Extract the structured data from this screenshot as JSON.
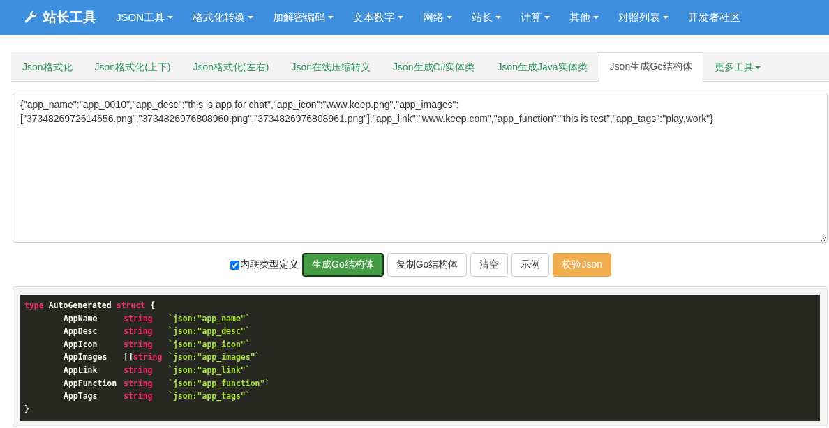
{
  "navbar": {
    "brand": "站长工具",
    "items": [
      {
        "label": "JSON工具",
        "dropdown": true
      },
      {
        "label": "格式化转换",
        "dropdown": true
      },
      {
        "label": "加解密编码",
        "dropdown": true
      },
      {
        "label": "文本数字",
        "dropdown": true
      },
      {
        "label": "网络",
        "dropdown": true
      },
      {
        "label": "站长",
        "dropdown": true
      },
      {
        "label": "计算",
        "dropdown": true
      },
      {
        "label": "其他",
        "dropdown": true
      },
      {
        "label": "对照列表",
        "dropdown": true
      },
      {
        "label": "开发者社区",
        "dropdown": false
      }
    ]
  },
  "tabs": [
    {
      "label": "Json格式化",
      "selected": false,
      "dropdown": false
    },
    {
      "label": "Json格式化(上下)",
      "selected": false,
      "dropdown": false
    },
    {
      "label": "Json格式化(左右)",
      "selected": false,
      "dropdown": false
    },
    {
      "label": "Json在线压缩转义",
      "selected": false,
      "dropdown": false
    },
    {
      "label": "Json生成C#实体类",
      "selected": false,
      "dropdown": false
    },
    {
      "label": "Json生成Java实体类",
      "selected": false,
      "dropdown": false
    },
    {
      "label": "Json生成Go结构体",
      "selected": true,
      "dropdown": false
    },
    {
      "label": "更多工具",
      "selected": false,
      "dropdown": true
    }
  ],
  "input": {
    "value": "{\"app_name\":\"app_0010\",\"app_desc\":\"this is app for chat\",\"app_icon\":\"www.keep.png\",\"app_images\":[\"3734826972614656.png\",\"3734826976808960.png\",\"3734826976808961.png\"],\"app_link\":\"www.keep.com\",\"app_function\":\"this is test\",\"app_tags\":\"play,work\"}"
  },
  "options": {
    "label": "内联类型定义",
    "checked": true
  },
  "buttons": [
    {
      "label": "生成Go结构体",
      "kind": "success"
    },
    {
      "label": "复制Go结构体",
      "kind": "default"
    },
    {
      "label": "清空",
      "kind": "default"
    },
    {
      "label": "示例",
      "kind": "default"
    },
    {
      "label": "校验Json",
      "kind": "warning"
    }
  ],
  "output": {
    "header": [
      {
        "kind": "keyword",
        "text": "type"
      },
      {
        "kind": "plain",
        "text": "AutoGenerated"
      },
      {
        "kind": "keyword",
        "text": "struct"
      },
      {
        "kind": "plain",
        "text": "{"
      }
    ],
    "fields": [
      {
        "name": "AppName",
        "type": "string",
        "tag": "`json:\"app_name\"`"
      },
      {
        "name": "AppDesc",
        "type": "string",
        "tag": "`json:\"app_desc\"`"
      },
      {
        "name": "AppIcon",
        "type": "string",
        "tag": "`json:\"app_icon\"`"
      },
      {
        "name": "AppImages",
        "prefix": "[]",
        "type": "string",
        "tag": "`json:\"app_images\"`"
      },
      {
        "name": "AppLink",
        "type": "string",
        "tag": "`json:\"app_link\"`"
      },
      {
        "name": "AppFunction",
        "type": "string",
        "tag": "`json:\"app_function\"`"
      },
      {
        "name": "AppTags",
        "type": "string",
        "tag": "`json:\"app_tags\"`"
      }
    ],
    "footer": "}"
  }
}
